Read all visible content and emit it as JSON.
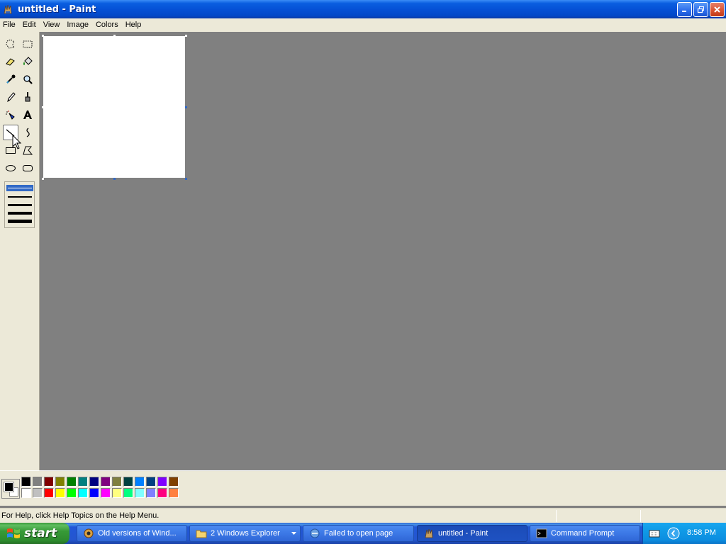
{
  "window": {
    "title": "untitled - Paint"
  },
  "menu": [
    "File",
    "Edit",
    "View",
    "Image",
    "Colors",
    "Help"
  ],
  "tools": [
    "free-form-select",
    "select",
    "eraser",
    "fill-with-color",
    "pick-color",
    "magnifier",
    "pencil",
    "brush",
    "airbrush",
    "text",
    "line",
    "curve",
    "rectangle",
    "polygon",
    "ellipse",
    "rounded-rectangle"
  ],
  "selected_tool": "line",
  "palette": {
    "foreground": "#000000",
    "background": "#ffffff",
    "row1": [
      "#000000",
      "#808080",
      "#800000",
      "#808000",
      "#008000",
      "#008080",
      "#000080",
      "#800080",
      "#808040",
      "#004040",
      "#0080ff",
      "#004080",
      "#8000ff",
      "#804000"
    ],
    "row2": [
      "#ffffff",
      "#c0c0c0",
      "#ff0000",
      "#ffff00",
      "#00ff00",
      "#00ffff",
      "#0000ff",
      "#ff00ff",
      "#ffff80",
      "#00ff80",
      "#80ffff",
      "#8080ff",
      "#ff0080",
      "#ff8040"
    ]
  },
  "status": {
    "text": "For Help, click Help Topics on the Help Menu."
  },
  "taskbar": {
    "start_label": "start",
    "tasks": [
      {
        "label": "Old versions of Wind...",
        "icon": "browser-icon"
      },
      {
        "label": "2 Windows Explorer",
        "icon": "folder-icon"
      },
      {
        "label": "Failed to open page",
        "icon": "ie-icon"
      },
      {
        "label": "untitled - Paint",
        "icon": "paint-icon"
      },
      {
        "label": "Command Prompt",
        "icon": "cmd-icon"
      }
    ],
    "clock": "8:58 PM"
  }
}
